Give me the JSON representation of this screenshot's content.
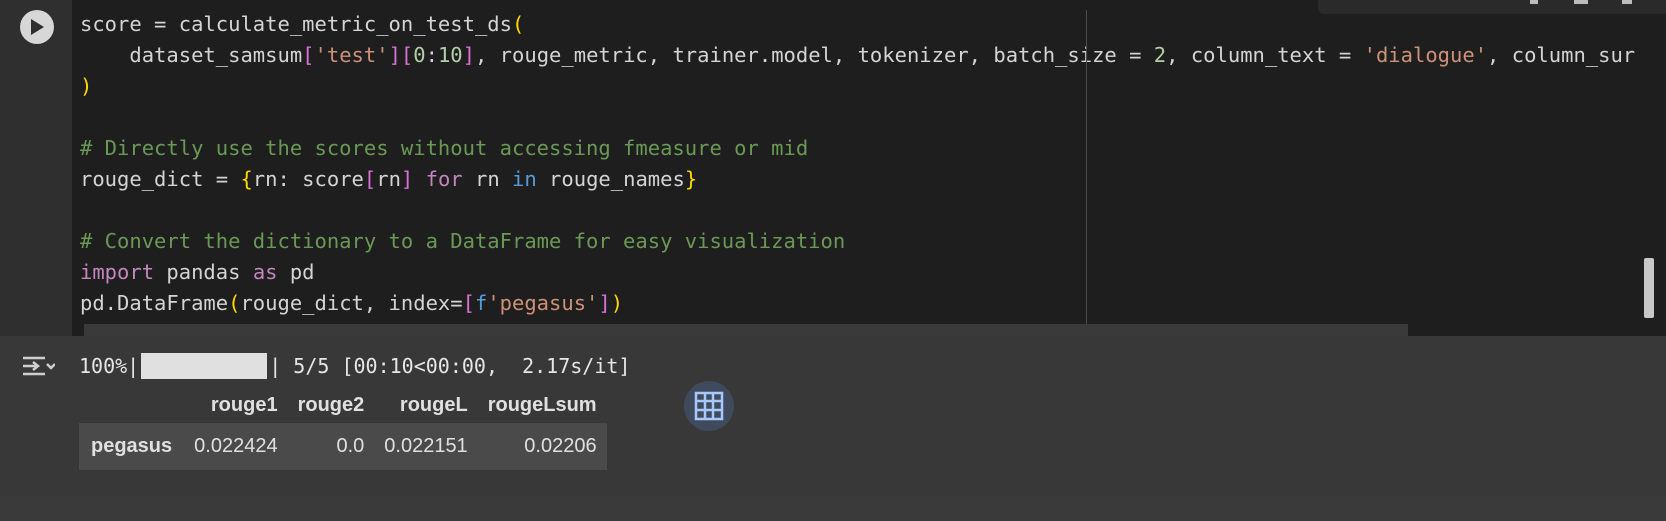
{
  "code_lines": [
    [
      {
        "t": "score = calculate_metric_on_test_ds",
        "c": ""
      },
      {
        "t": "(",
        "c": "b1"
      }
    ],
    [
      {
        "t": "    dataset_samsum",
        "c": ""
      },
      {
        "t": "[",
        "c": "b2"
      },
      {
        "t": "'test'",
        "c": "s"
      },
      {
        "t": "]",
        "c": "b2"
      },
      {
        "t": "[",
        "c": "b2"
      },
      {
        "t": "0",
        "c": "n"
      },
      {
        "t": ":",
        "c": ""
      },
      {
        "t": "10",
        "c": "n"
      },
      {
        "t": "]",
        "c": "b2"
      },
      {
        "t": ", rouge_metric, trainer.model, tokenizer, batch_size = ",
        "c": ""
      },
      {
        "t": "2",
        "c": "n"
      },
      {
        "t": ", column_text = ",
        "c": ""
      },
      {
        "t": "'dialogue'",
        "c": "s"
      },
      {
        "t": ", column_sur",
        "c": ""
      }
    ],
    [
      {
        "t": ")",
        "c": "b1"
      }
    ],
    [],
    [
      {
        "t": "# Directly use the scores without accessing fmeasure or mid",
        "c": "c"
      }
    ],
    [
      {
        "t": "rouge_dict = ",
        "c": ""
      },
      {
        "t": "{",
        "c": "b1"
      },
      {
        "t": "rn: score",
        "c": ""
      },
      {
        "t": "[",
        "c": "b2"
      },
      {
        "t": "rn",
        "c": ""
      },
      {
        "t": "]",
        "c": "b2"
      },
      {
        "t": " ",
        "c": ""
      },
      {
        "t": "for",
        "c": "k"
      },
      {
        "t": " rn ",
        "c": ""
      },
      {
        "t": "in",
        "c": "kb"
      },
      {
        "t": " rouge_names",
        "c": ""
      },
      {
        "t": "}",
        "c": "b1"
      }
    ],
    [],
    [
      {
        "t": "# Convert the dictionary to a DataFrame for easy visualization",
        "c": "c"
      }
    ],
    [
      {
        "t": "import",
        "c": "k"
      },
      {
        "t": " pandas ",
        "c": ""
      },
      {
        "t": "as",
        "c": "k"
      },
      {
        "t": " pd",
        "c": ""
      }
    ],
    [
      {
        "t": "pd.DataFrame",
        "c": ""
      },
      {
        "t": "(",
        "c": "b1"
      },
      {
        "t": "rouge_dict, index=",
        "c": ""
      },
      {
        "t": "[",
        "c": "b2"
      },
      {
        "t": "f",
        "c": "kb"
      },
      {
        "t": "'pegasus'",
        "c": "s"
      },
      {
        "t": "]",
        "c": "b2"
      },
      {
        "t": ")",
        "c": "b1"
      }
    ]
  ],
  "output": {
    "progress_percent_label": "100%|",
    "progress_fraction": 1.0,
    "progress_rest": "| 5/5 [00:10<00:00,  2.17s/it]"
  },
  "dataframe": {
    "columns": [
      "rouge1",
      "rouge2",
      "rougeL",
      "rougeLsum"
    ],
    "rows": [
      {
        "index": "pegasus",
        "values": [
          "0.022424",
          "0.0",
          "0.022151",
          "0.02206"
        ]
      }
    ]
  },
  "icons": {
    "run": "play-icon",
    "output_toggle": "output-collapse-icon",
    "table": "table-icon"
  },
  "colors": {
    "editor_bg": "#1e1e1e",
    "output_bg": "#383838",
    "comment": "#6a9955",
    "string": "#ce9178",
    "keyword": "#c586c0"
  }
}
